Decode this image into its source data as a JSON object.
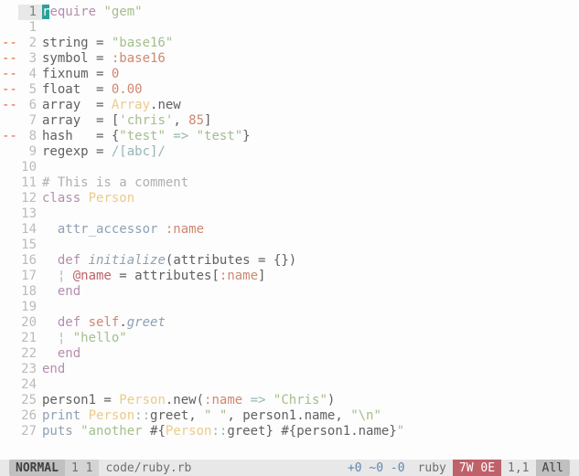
{
  "signs": [
    "",
    "",
    "--",
    "--",
    "--",
    "--",
    "--",
    "",
    "--",
    "",
    "",
    "",
    "",
    "",
    "",
    "",
    "",
    "",
    "",
    "",
    "",
    "",
    "",
    "",
    "",
    "",
    "",
    ""
  ],
  "lines": {
    "l1": {
      "require": "equire",
      "rch": "r",
      "q": "\"gem\""
    },
    "l3": {
      "a": "string = ",
      "b": "\"base16\""
    },
    "l4": {
      "a": "symbol = ",
      "b": ":base16"
    },
    "l5": {
      "a": "fixnum = ",
      "b": "0"
    },
    "l6": {
      "a": "float  = ",
      "b": "0.00"
    },
    "l7": {
      "a": "array  = ",
      "b": "Array",
      "c": ".new"
    },
    "l8": {
      "a": "array  = [",
      "b": "'chris'",
      "c": ", ",
      "d": "85",
      "e": "]"
    },
    "l9": {
      "a": "hash   = {",
      "b": "\"test\"",
      "c": " => ",
      "d": "\"test\"",
      "e": "}"
    },
    "l10": {
      "a": "regexp = ",
      "b": "/[abc]/"
    },
    "l12": {
      "a": "# This is a comment"
    },
    "l13": {
      "a": "class",
      "b": " ",
      "c": "Person"
    },
    "l15": {
      "a": "  ",
      "b": "attr_accessor",
      "c": " ",
      "d": ":name"
    },
    "l17": {
      "a": "  ",
      "b": "def",
      "c": " ",
      "d": "initialize",
      "e": "(attributes = {})"
    },
    "l18": {
      "a": "  ",
      "p": "¦ ",
      "b": "@name",
      "c": " = attributes[",
      "d": ":name",
      "e": "]"
    },
    "l19": {
      "a": "  ",
      "b": "end"
    },
    "l21": {
      "a": "  ",
      "b": "def",
      "c": " ",
      "d": "self",
      "e": ".",
      "f": "greet"
    },
    "l22": {
      "a": "  ",
      "p": "¦ ",
      "b": "\"hello\""
    },
    "l23": {
      "a": "  ",
      "b": "end"
    },
    "l24": {
      "a": "end"
    },
    "l26": {
      "a": "person1 = ",
      "b": "Person",
      "c": ".new(",
      "d": ":name",
      "e": " => ",
      "f": "\"Chris\"",
      "g": ")"
    },
    "l27": {
      "a": "print",
      "b": " ",
      "c": "Person",
      "d": "::",
      "e": "greet",
      "f": ", ",
      "g": "\" \"",
      "h": ", person1.name, ",
      "i": "\"\\n\""
    },
    "l28": {
      "a": "puts",
      "b": " ",
      "c": "\"another ",
      "d": "#{",
      "e": "Person",
      "f": "::",
      "g": "greet",
      "h": "}",
      "i": " ",
      "j": "#{",
      "k": "person1.name",
      "l": "}",
      "m": "\""
    }
  },
  "status": {
    "mode": "NORMAL",
    "pos": "1 1",
    "file": "code/ruby.rb",
    "hunk": "+0 ~0 -0",
    "filetype": "ruby",
    "lint": "7W 0E",
    "rowcol": "1,1",
    "percent": "All"
  }
}
